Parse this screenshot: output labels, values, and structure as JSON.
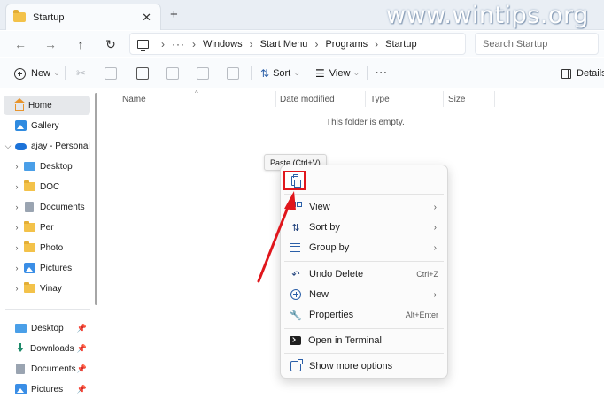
{
  "window": {
    "tab_title": "Startup",
    "tab_close": "✕",
    "new_tab": "+",
    "watermark": "www.wintips.org"
  },
  "nav": {
    "back": "←",
    "forward": "→",
    "up": "↑",
    "refresh": "↻",
    "overflow": "···",
    "breadcrumbs": [
      "Windows",
      "Start Menu",
      "Programs",
      "Startup"
    ],
    "search_placeholder": "Search Startup"
  },
  "toolbar": {
    "new_label": "New",
    "sort_label": "Sort",
    "view_label": "View",
    "more": "···",
    "details_label": "Details"
  },
  "sidebar": {
    "items": [
      {
        "label": "Home",
        "icon": "home-icon",
        "selected": true
      },
      {
        "label": "Gallery",
        "icon": "gallery-icon"
      },
      {
        "label": "ajay - Personal",
        "icon": "onedrive-cloud-icon",
        "expanded": true
      },
      {
        "label": "Desktop",
        "icon": "desktop-folder-icon"
      },
      {
        "label": "DOC",
        "icon": "folder-icon"
      },
      {
        "label": "Documents",
        "icon": "documents-icon"
      },
      {
        "label": "Per",
        "icon": "folder-icon"
      },
      {
        "label": "Photo",
        "icon": "folder-icon"
      },
      {
        "label": "Pictures",
        "icon": "pictures-icon"
      },
      {
        "label": "Vinay",
        "icon": "folder-icon"
      }
    ],
    "quick_access": [
      {
        "label": "Desktop",
        "icon": "desktop-folder-icon"
      },
      {
        "label": "Downloads",
        "icon": "download-icon"
      },
      {
        "label": "Documents",
        "icon": "documents-icon"
      },
      {
        "label": "Pictures",
        "icon": "pictures-icon"
      }
    ]
  },
  "content": {
    "columns": [
      "Name",
      "Date modified",
      "Type",
      "Size"
    ],
    "empty_message": "This folder is empty."
  },
  "tooltip": {
    "text": "Paste (Ctrl+V)"
  },
  "context_menu": {
    "items": [
      {
        "label": "View",
        "icon": "view-icon",
        "submenu": true
      },
      {
        "label": "Sort by",
        "icon": "sort-icon",
        "submenu": true
      },
      {
        "label": "Group by",
        "icon": "group-icon",
        "submenu": true
      },
      {
        "label": "Undo Delete",
        "icon": "undo-icon",
        "shortcut": "Ctrl+Z"
      },
      {
        "label": "New",
        "icon": "new-icon",
        "submenu": true
      },
      {
        "label": "Properties",
        "icon": "properties-icon",
        "shortcut": "Alt+Enter"
      },
      {
        "label": "Open in Terminal",
        "icon": "terminal-icon"
      },
      {
        "label": "Show more options",
        "icon": "more-options-icon"
      }
    ],
    "submenu_arrow": "›"
  },
  "colors": {
    "highlight_box": "#e0161c",
    "annotation_arrow": "#e0161c",
    "folder": "#f3c24a",
    "accent": "#2b5fa8"
  }
}
